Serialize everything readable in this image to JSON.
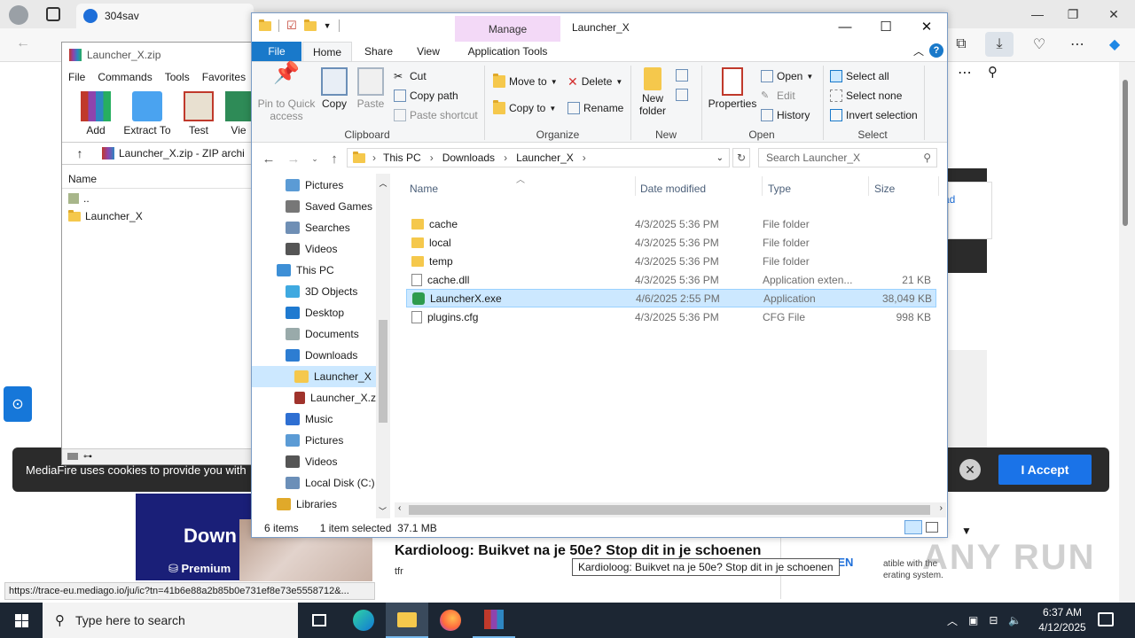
{
  "browser": {
    "tab_title": "304sav",
    "cookie_text": "MediaFire uses cookies to provide you with",
    "accept_label": "I Accept",
    "side_link": "ad",
    "promo_title": "Down",
    "promo_sub": "Premium",
    "ad_title": "Kardioloog: Buikvet na je 50e? Stop dit in je schoenen",
    "ad_source": "tfr",
    "ad_open": "NEN",
    "ad_right_text": "atible with the\nerating system.",
    "tooltip": "Kardioloog: Buikvet na je 50e? Stop dit in je schoenen",
    "status_url": "https://trace-eu.mediago.io/ju/ic?tn=41b6e88a2b85b0e731ef8e73e5558712&...",
    "watermark": "ANY RUN"
  },
  "winrar": {
    "title": "Launcher_X.zip",
    "menu": [
      "File",
      "Commands",
      "Tools",
      "Favorites"
    ],
    "tools": [
      "Add",
      "Extract To",
      "Test",
      "Vie"
    ],
    "address": "Launcher_X.zip - ZIP archi",
    "col_name": "Name",
    "rows": [
      "..",
      "Launcher_X"
    ]
  },
  "explorer": {
    "title": "Launcher_X",
    "manage_tab": "Manage",
    "tabs": {
      "file": "File",
      "home": "Home",
      "share": "Share",
      "view": "View",
      "app_tools": "Application Tools"
    },
    "clipboard": {
      "pin": "Pin to Quick\naccess",
      "copy": "Copy",
      "paste": "Paste",
      "cut": "Cut",
      "copy_path": "Copy path",
      "paste_shortcut": "Paste shortcut",
      "label": "Clipboard"
    },
    "organize": {
      "move_to": "Move to",
      "copy_to": "Copy to",
      "delete": "Delete",
      "rename": "Rename",
      "label": "Organize"
    },
    "new_group": {
      "new_folder": "New\nfolder",
      "label": "New"
    },
    "open_group": {
      "properties": "Properties",
      "open": "Open",
      "edit": "Edit",
      "history": "History",
      "label": "Open"
    },
    "select_group": {
      "select_all": "Select all",
      "select_none": "Select none",
      "invert": "Invert selection",
      "label": "Select"
    },
    "breadcrumb": [
      "This PC",
      "Downloads",
      "Launcher_X"
    ],
    "search_placeholder": "Search Launcher_X",
    "nav": [
      {
        "label": "Pictures",
        "icon": "pictures-icon"
      },
      {
        "label": "Saved Games",
        "icon": "saved-games-icon"
      },
      {
        "label": "Searches",
        "icon": "searches-icon"
      },
      {
        "label": "Videos",
        "icon": "videos-icon"
      },
      {
        "label": "This PC",
        "icon": "this-pc-icon"
      },
      {
        "label": "3D Objects",
        "icon": "3d-objects-icon"
      },
      {
        "label": "Desktop",
        "icon": "desktop-icon"
      },
      {
        "label": "Documents",
        "icon": "documents-icon"
      },
      {
        "label": "Downloads",
        "icon": "downloads-icon"
      },
      {
        "label": "Launcher_X",
        "icon": "folder-icon"
      },
      {
        "label": "Launcher_X.z",
        "icon": "winrar-archive-icon"
      },
      {
        "label": "Music",
        "icon": "music-icon"
      },
      {
        "label": "Pictures",
        "icon": "pictures-icon"
      },
      {
        "label": "Videos",
        "icon": "videos-icon"
      },
      {
        "label": "Local Disk (C:)",
        "icon": "local-disk-icon"
      },
      {
        "label": "Libraries",
        "icon": "libraries-icon"
      }
    ],
    "columns": {
      "name": "Name",
      "date": "Date modified",
      "type": "Type",
      "size": "Size"
    },
    "files": [
      {
        "name": "cache",
        "date": "4/3/2025 5:36 PM",
        "type": "File folder",
        "size": "",
        "icon": "folder-icon"
      },
      {
        "name": "local",
        "date": "4/3/2025 5:36 PM",
        "type": "File folder",
        "size": "",
        "icon": "folder-icon"
      },
      {
        "name": "temp",
        "date": "4/3/2025 5:36 PM",
        "type": "File folder",
        "size": "",
        "icon": "folder-icon"
      },
      {
        "name": "cache.dll",
        "date": "4/3/2025 5:36 PM",
        "type": "Application exten...",
        "size": "21 KB",
        "icon": "dll-icon"
      },
      {
        "name": "LauncherX.exe",
        "date": "4/6/2025 2:55 PM",
        "type": "Application",
        "size": "38,049 KB",
        "icon": "exe-icon"
      },
      {
        "name": "plugins.cfg",
        "date": "4/3/2025 5:36 PM",
        "type": "CFG File",
        "size": "998 KB",
        "icon": "file-icon"
      }
    ],
    "status": {
      "count": "6 items",
      "selected": "1 item selected",
      "size": "37.1 MB"
    }
  },
  "taskbar": {
    "search_placeholder": "Type here to search",
    "time": "6:37 AM",
    "date": "4/12/2025"
  }
}
